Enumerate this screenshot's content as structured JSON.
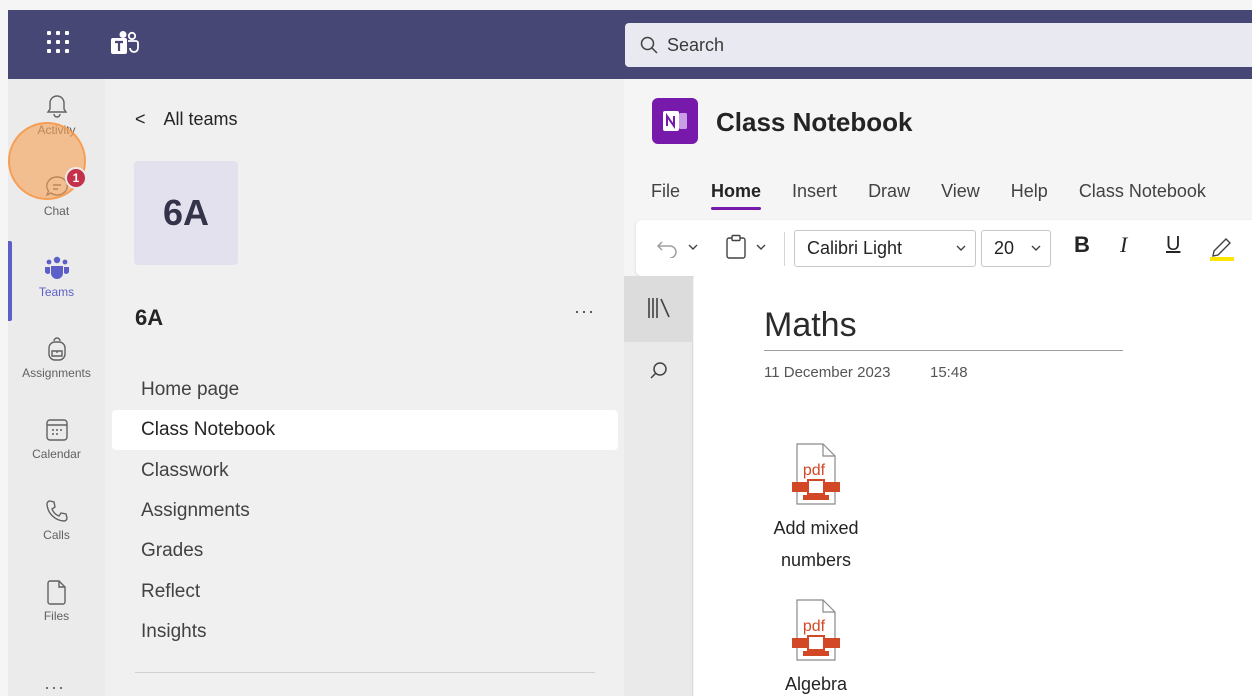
{
  "topbar": {
    "search_placeholder": "Search"
  },
  "rail": {
    "items": [
      {
        "label": "Activity",
        "icon": "bell-icon"
      },
      {
        "label": "Chat",
        "icon": "chat-icon",
        "badge": "1"
      },
      {
        "label": "Teams",
        "icon": "teams-icon",
        "active": true
      },
      {
        "label": "Assignments",
        "icon": "backpack-icon"
      },
      {
        "label": "Calendar",
        "icon": "calendar-icon"
      },
      {
        "label": "Calls",
        "icon": "phone-icon"
      },
      {
        "label": "Files",
        "icon": "file-icon"
      }
    ],
    "more": "···"
  },
  "panel": {
    "back_label": "All teams",
    "team_tile": "6A",
    "team_name": "6A",
    "more": "···",
    "nav": [
      {
        "label": "Home page"
      },
      {
        "label": "Class Notebook",
        "selected": true
      },
      {
        "label": "Classwork"
      },
      {
        "label": "Assignments"
      },
      {
        "label": "Grades"
      },
      {
        "label": "Reflect"
      },
      {
        "label": "Insights"
      }
    ]
  },
  "notebook": {
    "title": "Class Notebook",
    "menus": [
      "File",
      "Home",
      "Insert",
      "Draw",
      "View",
      "Help",
      "Class Notebook"
    ],
    "active_menu": "Home",
    "ribbon": {
      "font": "Calibri Light",
      "size": "20",
      "bold": "B",
      "italic": "I",
      "underline": "U"
    },
    "page": {
      "title": "Maths",
      "date": "11 December 2023",
      "time": "15:48",
      "attachments": [
        {
          "type": "pdf",
          "label_line1": "Add mixed",
          "label_line2": "numbers"
        },
        {
          "type": "pdf",
          "label_line1": "Algebra"
        }
      ]
    }
  },
  "colors": {
    "topbar": "#464775",
    "accent": "#5b5fc7",
    "onenote": "#7719aa",
    "pdf": "#d24726",
    "badge": "#c4314b"
  }
}
